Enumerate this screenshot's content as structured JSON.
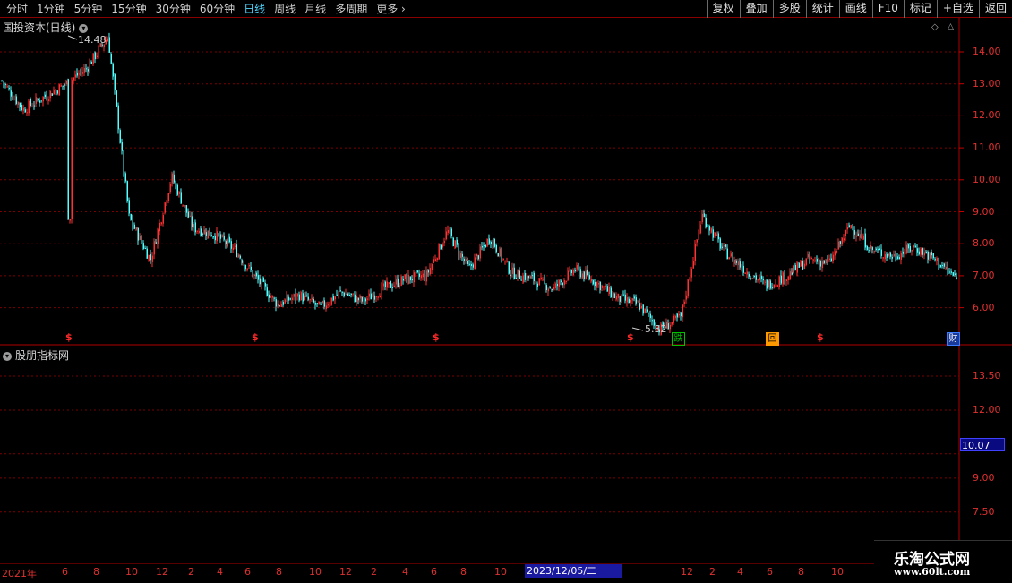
{
  "toolbar": {
    "periods": [
      "分时",
      "1分钟",
      "5分钟",
      "15分钟",
      "30分钟",
      "60分钟",
      "日线",
      "周线",
      "月线",
      "多周期",
      "更多"
    ],
    "active_period": "日线",
    "more_chevron": "›",
    "right_buttons": [
      "复权",
      "叠加",
      "多股",
      "统计",
      "画线",
      "F10",
      "标记",
      "+自选",
      "返回"
    ]
  },
  "main_panel": {
    "title": "国投资本(日线)",
    "high_label": "14.48",
    "low_label": "5.32",
    "price_axis": [
      "14.00",
      "13.00",
      "12.00",
      "11.00",
      "10.00",
      "9.00",
      "8.00",
      "7.00",
      "6.00"
    ]
  },
  "sub_panel": {
    "title": "股朋指标网",
    "axis": [
      "13.50",
      "12.00",
      "10.07",
      "9.00",
      "7.50"
    ],
    "current_value": "10.07"
  },
  "markers": {
    "dollar": [
      "$",
      "$",
      "$",
      "$",
      "$"
    ],
    "badges": [
      {
        "text": "跌",
        "color": "#00c000"
      },
      {
        "text": "回",
        "color": "#ff9900"
      },
      {
        "text": "财",
        "color": "#3a7bff"
      }
    ]
  },
  "time_axis": {
    "labels": [
      "2021年",
      "6",
      "8",
      "10",
      "12",
      "2",
      "4",
      "6",
      "8",
      "10",
      "12",
      "2",
      "4",
      "6",
      "8",
      "10",
      "12",
      "2",
      "4",
      "6",
      "8",
      "10"
    ],
    "cursor_date": "2023/12/05/二"
  },
  "watermark": {
    "line1": "乐淘公式网",
    "line2": "www.60lt.com"
  },
  "colors": {
    "up": "#ff3232",
    "down": "#54ffff",
    "grid": "#8a0000",
    "axis_text": "#e03030"
  },
  "chart_data": {
    "type": "candlestick",
    "approx_close_path": [
      {
        "x": "2021-01",
        "y": 13.1
      },
      {
        "x": "2021-02",
        "y": 12.2
      },
      {
        "x": "2021-03",
        "y": 12.6
      },
      {
        "x": "2021-04",
        "y": 13.0
      },
      {
        "x": "2021-05",
        "y": 13.5
      },
      {
        "x": "2021-06",
        "y": 14.48
      },
      {
        "x": "2021-07",
        "y": 8.8
      },
      {
        "x": "2021-08",
        "y": 7.5
      },
      {
        "x": "2021-09",
        "y": 10.1
      },
      {
        "x": "2021-10",
        "y": 8.5
      },
      {
        "x": "2021-11",
        "y": 8.3
      },
      {
        "x": "2021-12",
        "y": 7.8
      },
      {
        "x": "2022-01",
        "y": 6.9
      },
      {
        "x": "2022-02",
        "y": 6.1
      },
      {
        "x": "2022-03",
        "y": 6.4
      },
      {
        "x": "2022-04",
        "y": 6.0
      },
      {
        "x": "2022-05",
        "y": 6.5
      },
      {
        "x": "2022-06",
        "y": 6.2
      },
      {
        "x": "2022-07",
        "y": 6.6
      },
      {
        "x": "2022-08",
        "y": 6.9
      },
      {
        "x": "2022-09",
        "y": 7.0
      },
      {
        "x": "2022-10",
        "y": 8.4
      },
      {
        "x": "2022-11",
        "y": 7.2
      },
      {
        "x": "2022-12",
        "y": 8.2
      },
      {
        "x": "2023-01",
        "y": 7.1
      },
      {
        "x": "2023-02",
        "y": 6.9
      },
      {
        "x": "2023-03",
        "y": 6.6
      },
      {
        "x": "2023-04",
        "y": 7.2
      },
      {
        "x": "2023-05",
        "y": 6.8
      },
      {
        "x": "2023-06",
        "y": 6.3
      },
      {
        "x": "2023-07",
        "y": 6.1
      },
      {
        "x": "2023-08",
        "y": 5.32
      },
      {
        "x": "2023-09",
        "y": 5.7
      },
      {
        "x": "2023-10",
        "y": 8.9
      },
      {
        "x": "2023-11",
        "y": 7.8
      },
      {
        "x": "2023-12",
        "y": 7.2
      },
      {
        "x": "2024-01",
        "y": 6.7
      },
      {
        "x": "2024-02",
        "y": 7.0
      },
      {
        "x": "2024-03",
        "y": 7.5
      },
      {
        "x": "2024-04",
        "y": 7.4
      },
      {
        "x": "2024-05",
        "y": 8.6
      },
      {
        "x": "2024-06",
        "y": 7.8
      },
      {
        "x": "2024-07",
        "y": 7.6
      },
      {
        "x": "2024-08",
        "y": 7.9
      },
      {
        "x": "2024-09",
        "y": 7.5
      },
      {
        "x": "2024-10",
        "y": 6.9
      }
    ],
    "ylim": [
      5.0,
      14.8
    ]
  }
}
